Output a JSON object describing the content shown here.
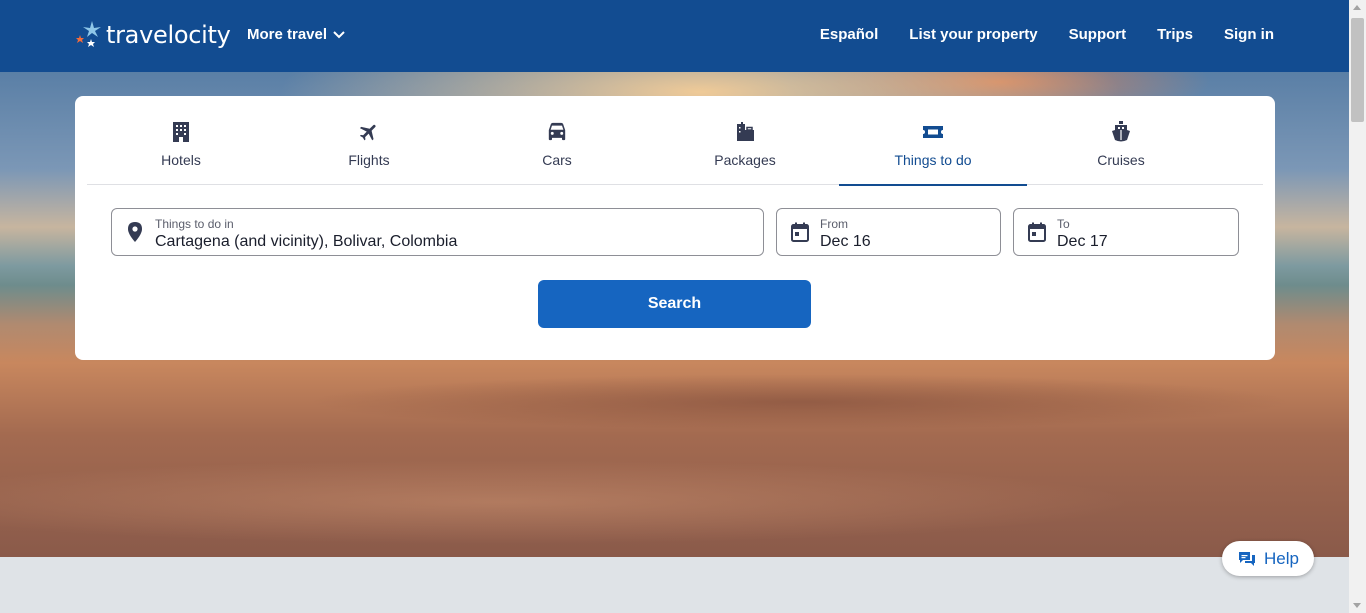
{
  "header": {
    "logo_text": "travelocity",
    "more_travel_label": "More travel",
    "nav": [
      {
        "label": "Español"
      },
      {
        "label": "List your property"
      },
      {
        "label": "Support"
      },
      {
        "label": "Trips"
      },
      {
        "label": "Sign in"
      }
    ]
  },
  "search": {
    "tabs": [
      {
        "label": "Hotels",
        "icon": "hotel-icon"
      },
      {
        "label": "Flights",
        "icon": "plane-icon"
      },
      {
        "label": "Cars",
        "icon": "car-icon"
      },
      {
        "label": "Packages",
        "icon": "packages-icon"
      },
      {
        "label": "Things to do",
        "icon": "ticket-icon",
        "active": true
      },
      {
        "label": "Cruises",
        "icon": "cruise-icon"
      }
    ],
    "destination": {
      "label": "Things to do in",
      "value": "Cartagena (and vicinity), Bolivar, Colombia"
    },
    "from": {
      "label": "From",
      "value": "Dec 16"
    },
    "to": {
      "label": "To",
      "value": "Dec 17"
    },
    "button_label": "Search"
  },
  "help": {
    "label": "Help"
  },
  "colors": {
    "brand_blue": "#124c91",
    "button_blue": "#1665c0",
    "logo_star_orange": "#f26c3c",
    "logo_star_light": "#8fc7e8"
  }
}
